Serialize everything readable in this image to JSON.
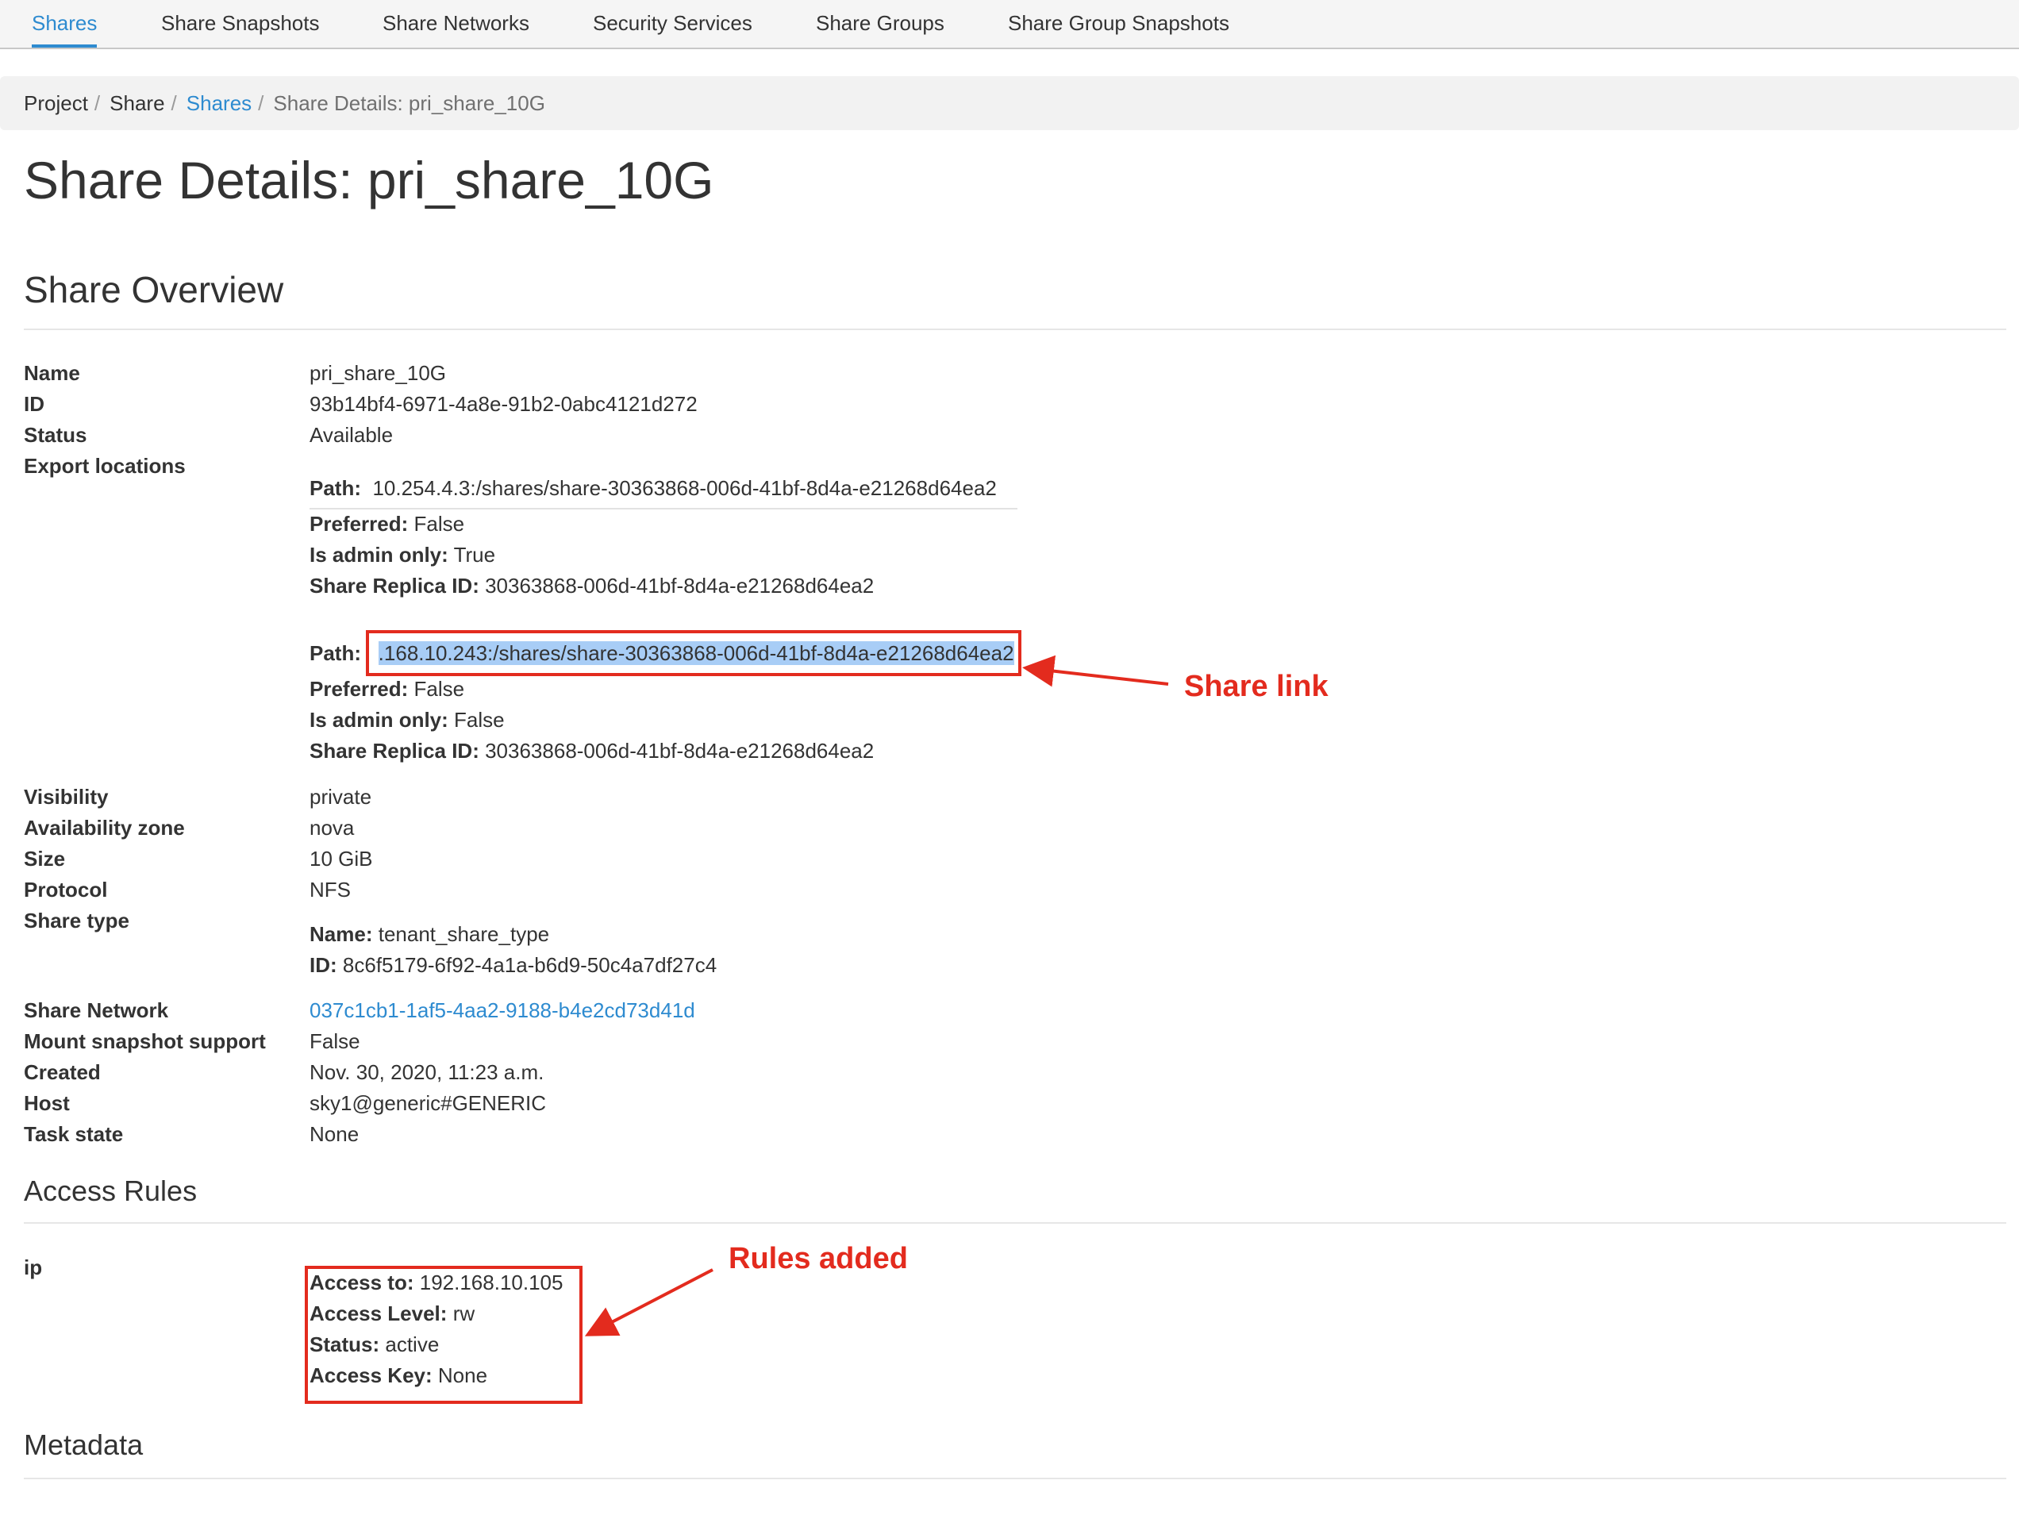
{
  "tabs": [
    {
      "label": "Shares"
    },
    {
      "label": "Share Snapshots"
    },
    {
      "label": "Share Networks"
    },
    {
      "label": "Security Services"
    },
    {
      "label": "Share Groups"
    },
    {
      "label": "Share Group Snapshots"
    }
  ],
  "breadcrumb": {
    "items": [
      "Project",
      "Share",
      "Shares",
      "Share Details: pri_share_10G"
    ],
    "separator": "/"
  },
  "page_title": "Share Details: pri_share_10G",
  "overview": {
    "heading": "Share Overview",
    "labels": {
      "name": "Name",
      "id": "ID",
      "status": "Status",
      "export_locations": "Export locations",
      "visibility": "Visibility",
      "availability_zone": "Availability zone",
      "size": "Size",
      "protocol": "Protocol",
      "share_type": "Share type",
      "share_network": "Share Network",
      "mount_snapshot_support": "Mount snapshot support",
      "created": "Created",
      "host": "Host",
      "task_state": "Task state"
    },
    "name": "pri_share_10G",
    "id": "93b14bf4-6971-4a8e-91b2-0abc4121d272",
    "status": "Available",
    "export_locations": [
      {
        "path_label": "Path:",
        "path": "10.254.4.3:/shares/share-30363868-006d-41bf-8d4a-e21268d64ea2",
        "preferred_label": "Preferred:",
        "preferred": "False",
        "admin_label": "Is admin only:",
        "admin_only": "True",
        "replica_label": "Share Replica ID:",
        "replica_id": "30363868-006d-41bf-8d4a-e21268d64ea2"
      },
      {
        "path_label": "Path:",
        "path": ".168.10.243:/shares/share-30363868-006d-41bf-8d4a-e21268d64ea2",
        "preferred_label": "Preferred:",
        "preferred": "False",
        "admin_label": "Is admin only:",
        "admin_only": "False",
        "replica_label": "Share Replica ID:",
        "replica_id": "30363868-006d-41bf-8d4a-e21268d64ea2"
      }
    ],
    "visibility": "private",
    "availability_zone": "nova",
    "size": "10 GiB",
    "protocol": "NFS",
    "share_type": {
      "name_label": "Name:",
      "name": "tenant_share_type",
      "id_label": "ID:",
      "id": "8c6f5179-6f92-4a1a-b6d9-50c4a7df27c4"
    },
    "share_network": "037c1cb1-1af5-4aa2-9188-b4e2cd73d41d",
    "mount_snapshot_support": "False",
    "created": "Nov. 30, 2020, 11:23 a.m.",
    "host": "sky1@generic#GENERIC",
    "task_state": "None"
  },
  "access_rules": {
    "heading": "Access Rules",
    "type_label": "ip",
    "access_to_label": "Access to:",
    "access_to": "192.168.10.105",
    "access_level_label": "Access Level:",
    "access_level": "rw",
    "status_label": "Status:",
    "status": "active",
    "access_key_label": "Access Key:",
    "access_key": "None"
  },
  "metadata": {
    "heading": "Metadata"
  },
  "annotations": {
    "share_link": "Share link",
    "rules_added": "Rules added",
    "color": "#e32b1e"
  },
  "colors": {
    "link": "#2e8bd0",
    "text": "#333333",
    "selection": "#a8cdf6"
  }
}
